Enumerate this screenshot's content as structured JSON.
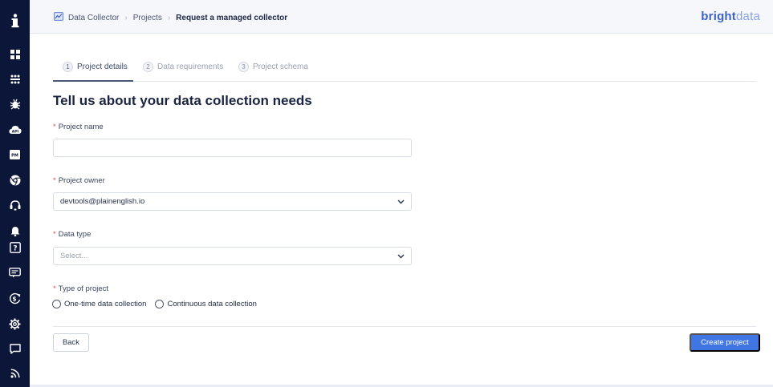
{
  "header": {
    "breadcrumbs": [
      "Data Collector",
      "Projects"
    ],
    "current_page": "Request a managed collector",
    "logo_primary": "bright",
    "logo_secondary": "data"
  },
  "sidebar": {
    "icons": [
      "info-icon",
      "dashboard-icon",
      "proxies-icon",
      "collector-icon",
      "api-icon",
      "pm-icon",
      "browser-icon",
      "support-icon",
      "notifications-icon",
      "help-icon",
      "billing-icon",
      "payment-icon",
      "settings-icon",
      "messages-icon",
      "feed-icon"
    ],
    "pm_text": "PM",
    "api_text": "API"
  },
  "steps": [
    {
      "number": "1",
      "label": "Project details",
      "active": true
    },
    {
      "number": "2",
      "label": "Data requirements",
      "active": false
    },
    {
      "number": "3",
      "label": "Project schema",
      "active": false
    }
  ],
  "form": {
    "title": "Tell us about your data collection needs",
    "required_marker": "*",
    "project_name": {
      "label": "Project name",
      "value": "",
      "placeholder": ""
    },
    "project_owner": {
      "label": "Project owner",
      "value": "devtools@plainenglish.io"
    },
    "data_type": {
      "label": "Data type",
      "placeholder": "Select..."
    },
    "project_type": {
      "label": "Type of project",
      "options": [
        "One-time data collection",
        "Continuous data collection"
      ]
    }
  },
  "actions": {
    "back_label": "Back",
    "create_label": "Create project"
  },
  "colors": {
    "sidebar_bg": "#0b1638",
    "primary": "#3f76e4",
    "brand": "#3d63c9",
    "required": "#d9534f"
  }
}
